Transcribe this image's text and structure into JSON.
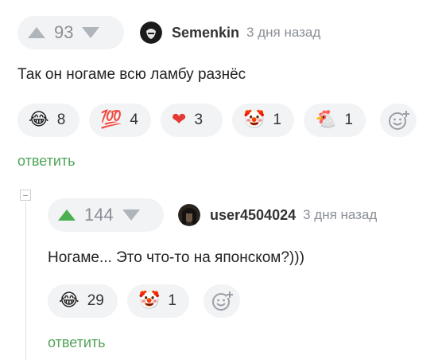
{
  "comment": {
    "votes": "93",
    "author": "Semenkin",
    "time": "3 дня назад",
    "text": "Так он ногаме всю ламбу разнёс",
    "reactions": [
      {
        "emoji": "😂",
        "count": "8"
      },
      {
        "emoji": "💯",
        "count": "4"
      },
      {
        "emoji": "❤",
        "count": "3"
      },
      {
        "emoji": "🤡",
        "count": "1"
      },
      {
        "emoji": "🐔",
        "count": "1"
      }
    ],
    "reply_label": "ответить"
  },
  "reply": {
    "votes": "144",
    "author": "user4504024",
    "time": "3 дня назад",
    "text": "Ногаме... Это что-то на японском?)))",
    "reactions": [
      {
        "emoji": "😂",
        "count": "29"
      },
      {
        "emoji": "🤡",
        "count": "1"
      }
    ],
    "reply_label": "ответить"
  },
  "colors": {
    "upvote_active": "#4caf50",
    "arrow_inactive": "#b0b5bb",
    "reply_link": "#51a45a",
    "pill_bg": "#f2f3f5"
  }
}
